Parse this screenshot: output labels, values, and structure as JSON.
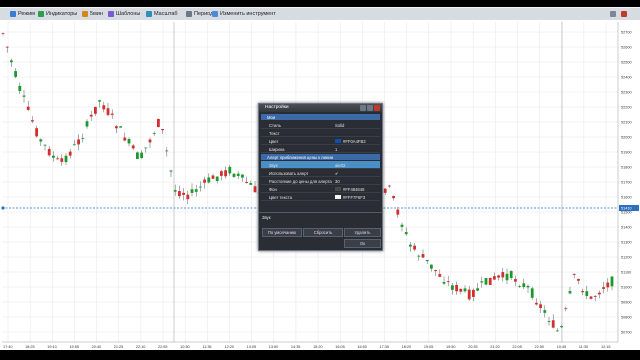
{
  "toolbar": {
    "items": [
      "Режим",
      "Индикаторы",
      "5мин",
      "Шаблоны",
      "Масштаб",
      "Период",
      "Изменить инструмент"
    ],
    "right_icons": [
      "restore-window-icon",
      "close-window-icon"
    ]
  },
  "chart_data": {
    "type": "candlestick",
    "y_axis": {
      "ticks": [
        "52700",
        "52600",
        "52500",
        "52400",
        "52300",
        "52200",
        "52100",
        "52000",
        "51900",
        "51800",
        "51700",
        "51600",
        "51500",
        "51400",
        "51300",
        "51200",
        "51100",
        "51000",
        "50900",
        "50800",
        "50700"
      ]
    },
    "x_axis": {
      "ticks": [
        "17:40",
        "18:25",
        "19:10",
        "19:55",
        "20:40",
        "21:25",
        "22:10",
        "22:55",
        "10:50",
        "11:35",
        "12:20",
        "13:05",
        "13:50",
        "14:35",
        "15:20",
        "16:05",
        "16:50",
        "17:35",
        "18:20",
        "19:05",
        "19:50",
        "20:35",
        "21:20",
        "22:05",
        "22:50",
        "10:45",
        "11:30",
        "12:15"
      ]
    },
    "price_label": "51410",
    "cursor_value": "51410",
    "colors": {
      "up": "#1a9a2e",
      "down": "#d32f2f",
      "grid": "#e6e6e6"
    }
  },
  "dialog": {
    "title": "Настройки",
    "sections": [
      {
        "title": "Мои",
        "rows": [
          {
            "label": "Стиль",
            "value": "Solid"
          },
          {
            "label": "Текст",
            "value": ""
          },
          {
            "label": "Цвет",
            "value": "#FF0A4FB3",
            "swatch": "#0a4fb3"
          },
          {
            "label": "Ширина",
            "value": "1"
          }
        ]
      },
      {
        "title": "Алерт приближения цены к линии",
        "rows": [
          {
            "label": "Звук",
            "value": "alert2",
            "selected": true
          },
          {
            "label": "Использовать алерт",
            "value": "✔"
          },
          {
            "label": "Расстояние до цены для алерта",
            "value": "30"
          },
          {
            "label": "Фон",
            "value": "#FF484848",
            "swatch": "#484848"
          },
          {
            "label": "Цвет текста",
            "value": "#FFF7F6F3",
            "swatch": "#f7f6f3"
          }
        ]
      }
    ],
    "footer_title": "Звук",
    "buttons": {
      "default": "По умолчанию",
      "reset": "Сбросить",
      "delete": "Удалить",
      "ok": "Ок"
    }
  }
}
